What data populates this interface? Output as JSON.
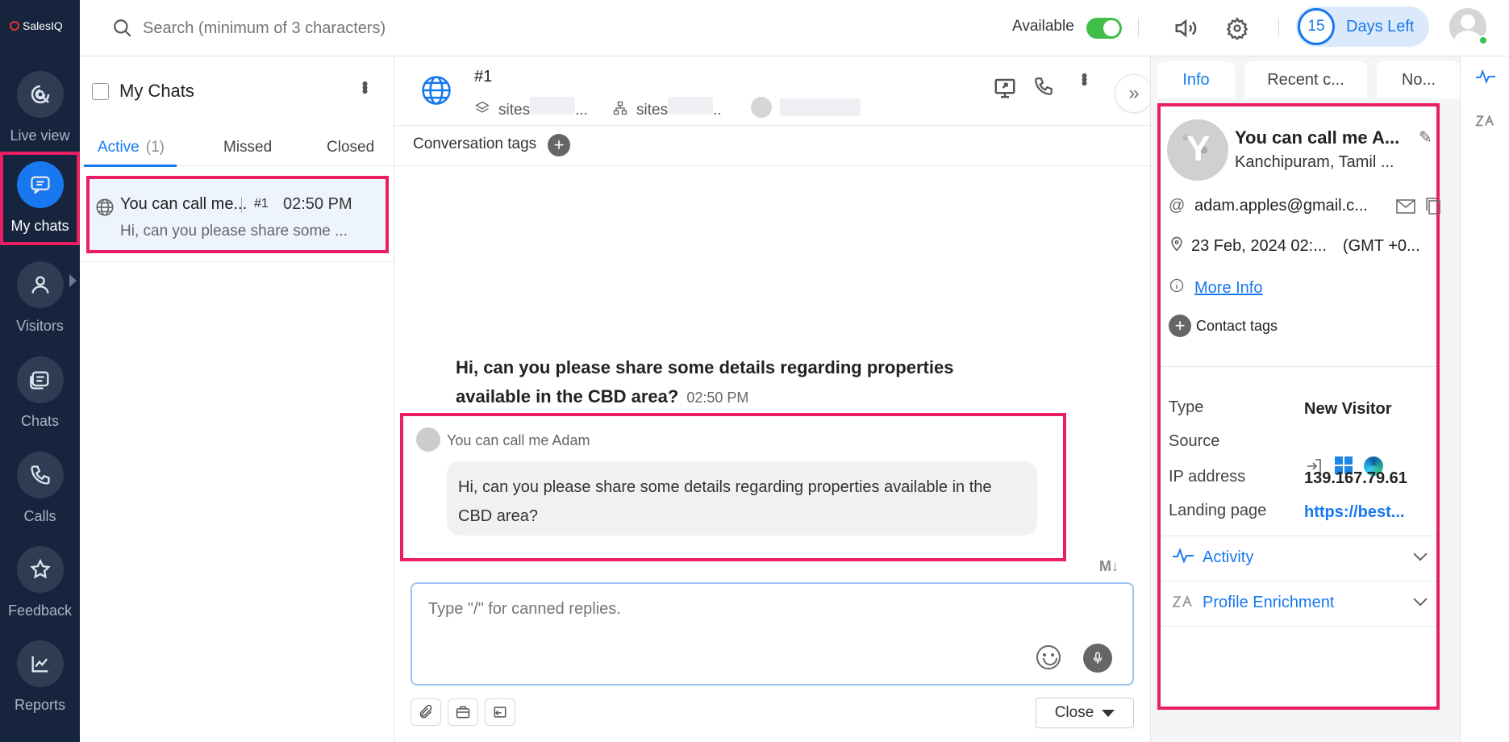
{
  "brand": {
    "name": "SalesIQ",
    "logo_color": "#e0322a"
  },
  "rail": {
    "items": [
      {
        "label": "Live view",
        "icon": "live-view-icon"
      },
      {
        "label": "My chats",
        "icon": "chat-bubble-icon",
        "active": true
      },
      {
        "label": "Visitors",
        "icon": "person-icon"
      },
      {
        "label": "Chats",
        "icon": "chats-icon"
      },
      {
        "label": "Calls",
        "icon": "phone-icon"
      },
      {
        "label": "Feedback",
        "icon": "star-icon"
      },
      {
        "label": "Reports",
        "icon": "reports-icon"
      }
    ]
  },
  "topbar": {
    "search_placeholder": "Search (minimum of 3 characters)",
    "availability_label": "Available",
    "availability_on": true,
    "trial_days": "15",
    "trial_text": "Days Left"
  },
  "chatlist": {
    "title": "My Chats",
    "tabs": [
      {
        "label": "Active",
        "count": "(1)"
      },
      {
        "label": "Missed"
      },
      {
        "label": "Closed"
      }
    ],
    "items": [
      {
        "name": "You can call me...",
        "id": "#1",
        "time": "02:50 PM",
        "preview": "Hi, can you please share some ..."
      }
    ]
  },
  "conversation": {
    "number": "#1",
    "meta": [
      {
        "icon": "layers-icon",
        "text": "sites",
        "suffix": "..."
      },
      {
        "icon": "hierarchy-icon",
        "text": "sites",
        "suffix": ".."
      }
    ],
    "tags_label": "Conversation tags",
    "headline_message": "Hi, can you please share some details regarding properties available in the CBD area?",
    "headline_time": "02:50 PM",
    "sender": "You can call me Adam",
    "message": "Hi, can you please share some details regarding properties available in the CBD area?",
    "markdown_badge": "M↓",
    "composer_placeholder": "Type \"/\" for canned replies.",
    "close_label": "Close"
  },
  "info": {
    "tabs": [
      "Info",
      "Recent c...",
      "No..."
    ],
    "name": "You can call me A...",
    "location": "Kanchipuram, Tamil ...",
    "email": "adam.apples@gmail.c...",
    "date": "23 Feb, 2024 02:...",
    "timezone": "(GMT +0...",
    "more_info": "More Info",
    "contact_tags": "Contact tags",
    "fields": [
      {
        "key": "Type",
        "value": "New Visitor"
      },
      {
        "key": "Source",
        "value": ""
      },
      {
        "key": "IP address",
        "value": "139.167.79.61"
      },
      {
        "key": "Landing page",
        "value": "https://best..."
      }
    ],
    "sections": [
      {
        "label": "Activity",
        "icon": "activity-icon"
      },
      {
        "label": "Profile Enrichment",
        "icon": "enrichment-icon"
      }
    ]
  },
  "colors": {
    "accent": "#1778ef",
    "highlight": "#e91e63",
    "rail": "#16253d",
    "online": "#35c24b"
  }
}
